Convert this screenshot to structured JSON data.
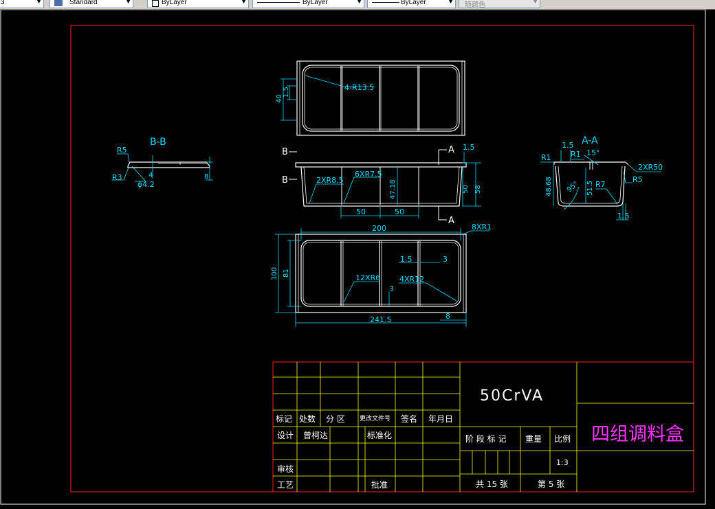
{
  "toolbar": {
    "text_style_prefix": "3",
    "text_style": "Standard",
    "layer": "ByLayer",
    "linetype": "ByLayer",
    "lineweight": "ByLayer",
    "plot_style": "随颜色"
  },
  "drawing": {
    "sections": {
      "bb": "B-B",
      "aa": "A-A",
      "b_mark": "B",
      "a_mark": "A"
    },
    "dims_top": {
      "r": "4-R13.5",
      "h40": "40",
      "t15": "1.5"
    },
    "dims_front": {
      "r2": "2XR8.5",
      "r6": "6XR7.5",
      "h4718": "47.18",
      "w50a": "50",
      "w50b": "50",
      "h50": "50",
      "h58": "58",
      "t15": "1.5"
    },
    "dims_plan": {
      "w200": "200",
      "r8": "8XR1",
      "h100": "100",
      "h81": "81",
      "t15": "1.5",
      "t3": "3",
      "r12a": "12XR6",
      "r4": "4XR12",
      "t3b": "3",
      "w2415": "241.5",
      "w8": "8"
    },
    "dims_bb": {
      "r5": "R5",
      "r3": "R3",
      "phi": "ϕ4.2",
      "h4": "4",
      "h8": "8"
    },
    "dims_aa": {
      "t15": "1.5",
      "r1l": "R1",
      "r1r": "R1",
      "a15": "15°",
      "r50": "2XR50",
      "h4868": "48.68",
      "h515": "51.5",
      "r7": "R7",
      "r5": "R5",
      "a95": "95°",
      "t15b": "1.5"
    }
  },
  "title_block": {
    "material": "50CrVA",
    "title": "四组调料盒",
    "row_headers": [
      "标记",
      "处数",
      "分 区",
      "更改文件号",
      "签名",
      "年月日"
    ],
    "design_label": "设计",
    "designer": "曾柯达",
    "standardize_label": "标准化",
    "review_label": "审核",
    "process_label": "工艺",
    "approve_label": "批准",
    "stage_label": "阶 段 标 记",
    "weight_label": "重量",
    "scale_label": "比例",
    "scale_value": "1:3",
    "total_sheets": "共 15 张",
    "sheet_no": "第 5 张"
  },
  "colors": {
    "frame": "#ff0000",
    "geometry": "#ffffff",
    "dims": "#00ffff",
    "title_grid": "#ffff00",
    "title_text": "#ff00ff"
  }
}
